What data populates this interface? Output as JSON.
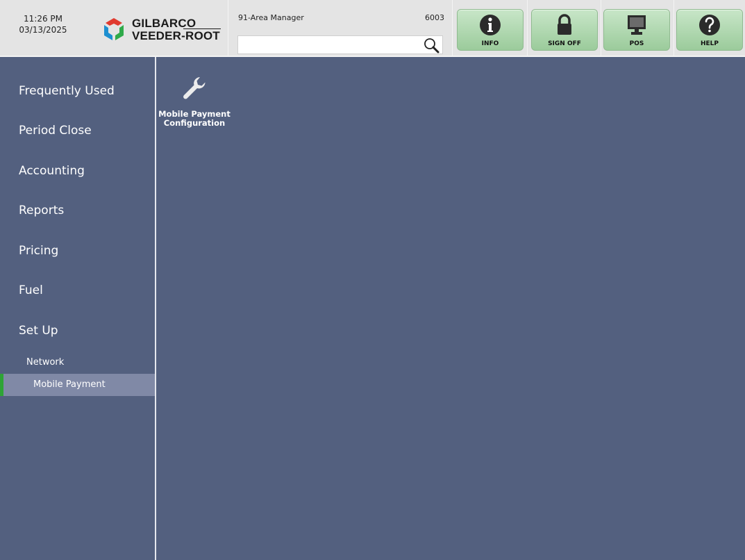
{
  "header": {
    "time": "11:26 PM",
    "date": "03/13/2025",
    "logo_line1": "GILBARCO",
    "logo_line2": "VEEDER-ROOT",
    "user_name": "91-Area Manager",
    "user_id": "6003",
    "search": {
      "value": "",
      "placeholder": ""
    }
  },
  "toolbar": [
    {
      "label": "INFO",
      "icon": "info-icon"
    },
    {
      "label": "SIGN OFF",
      "icon": "lock-icon"
    },
    {
      "label": "POS",
      "icon": "monitor-icon"
    },
    {
      "label": "HELP",
      "icon": "help-icon"
    }
  ],
  "sidebar": {
    "items": [
      {
        "label": "Frequently Used"
      },
      {
        "label": "Period Close"
      },
      {
        "label": "Accounting"
      },
      {
        "label": "Reports"
      },
      {
        "label": "Pricing"
      },
      {
        "label": "Fuel"
      },
      {
        "label": "Set Up"
      }
    ],
    "sub_item": {
      "label": "Network"
    },
    "active_item": {
      "label": "Mobile Payment"
    }
  },
  "content": {
    "tiles": [
      {
        "label_line1": "Mobile Payment",
        "label_line2": "Configuration",
        "icon": "wrench-icon"
      }
    ]
  },
  "colors": {
    "background": "#53607f",
    "header": "#e4e4e4",
    "button_green": "#a8d3a8",
    "active_highlight": "#8089a6",
    "active_marker": "#2ea436"
  }
}
